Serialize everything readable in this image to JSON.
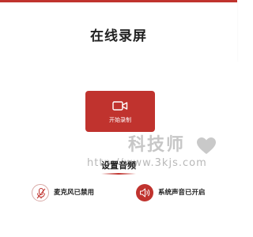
{
  "header": {
    "title": "在线录屏"
  },
  "record": {
    "label": "开始录制",
    "icon": "video-camera-icon"
  },
  "settings": {
    "section_title": "设置音频",
    "microphone": {
      "label": "麦克风已禁用",
      "icon": "microphone-muted-icon",
      "enabled": false
    },
    "system_audio": {
      "label": "系统声音已开启",
      "icon": "speaker-icon",
      "enabled": true
    }
  },
  "watermark": {
    "text": "科技师",
    "url": "http://www.3kjs.com"
  },
  "colors": {
    "accent": "#c0332e",
    "title": "#222222",
    "watermark": "#c7c7c7"
  }
}
